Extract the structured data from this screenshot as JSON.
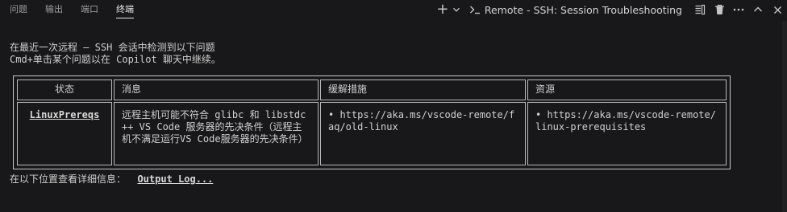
{
  "panel": {
    "tabs": [
      {
        "label": "问题"
      },
      {
        "label": "输出"
      },
      {
        "label": "端口"
      },
      {
        "label": "终端"
      }
    ],
    "active_tab": "终端",
    "terminal_title": "Remote - SSH: Session Troubleshooting"
  },
  "terminal": {
    "lines": [
      "在最近一次远程 — SSH 会话中检测到以下问题",
      "Cmd+单击某个问题以在 Copilot 聊天中继续。"
    ],
    "table": {
      "headers": [
        "状态",
        "消息",
        "缓解措施",
        "资源"
      ],
      "row": {
        "status": "LinuxPrereqs",
        "message": "远程主机可能不符合 glibc 和 libstdc++ VS Code 服务器的先决条件（远程主机不满足运行VS Code服务器的先决条件）",
        "mitigation": "• https://aka.ms/vscode-remote/faq/old-linux",
        "resource": "• https://aka.ms/vscode-remote/linux-prerequisites"
      }
    },
    "footer_prefix": "在以下位置查看详细信息：  ",
    "footer_link": "Output Log..."
  }
}
